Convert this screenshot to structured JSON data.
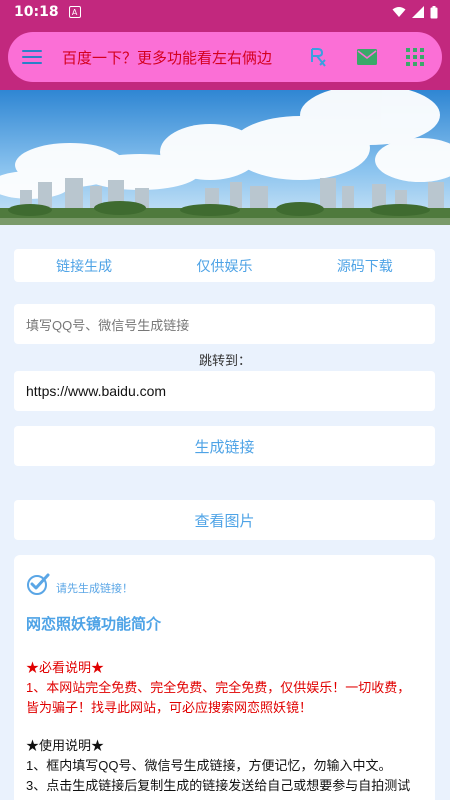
{
  "status_bar": {
    "time": "10:18"
  },
  "nav": {
    "title": "百度一下？更多功能看左右俩边",
    "icons": [
      "menu-icon",
      "rx-icon",
      "mail-icon",
      "grid-icon"
    ]
  },
  "tabs": [
    "链接生成",
    "仅供娱乐",
    "源码下载"
  ],
  "form": {
    "qq_placeholder": "填写QQ号、微信号生成链接",
    "jump_label": "跳转到：",
    "url_value": "https://www.baidu.com",
    "generate_button": "生成链接",
    "view_button": "查看图片"
  },
  "notice": {
    "text": "请先生成链接！"
  },
  "intro": {
    "title": "网恋照妖镜功能简介",
    "must_read_title": "★必看说明★",
    "must_read_text": "1、本网站完全免费、完全免费、完全免费，仅供娱乐！一切收费，皆为骗子！找寻此网站，可必应搜索网恋照妖镜！",
    "usage_title": "★使用说明★",
    "usage_1": "1、框内填写QQ号、微信号生成链接，方便记忆，勿输入中文。",
    "usage_3": "3、点击生成链接后复制生成的链接发送给自己或想要参与自拍测试"
  },
  "colors": {
    "status_bar": "#c2287e",
    "nav_pill": "#fb6fd6",
    "accent_blue": "#4ea3e6",
    "title_red": "#d4001f",
    "page_bg": "#eaf2fd"
  }
}
